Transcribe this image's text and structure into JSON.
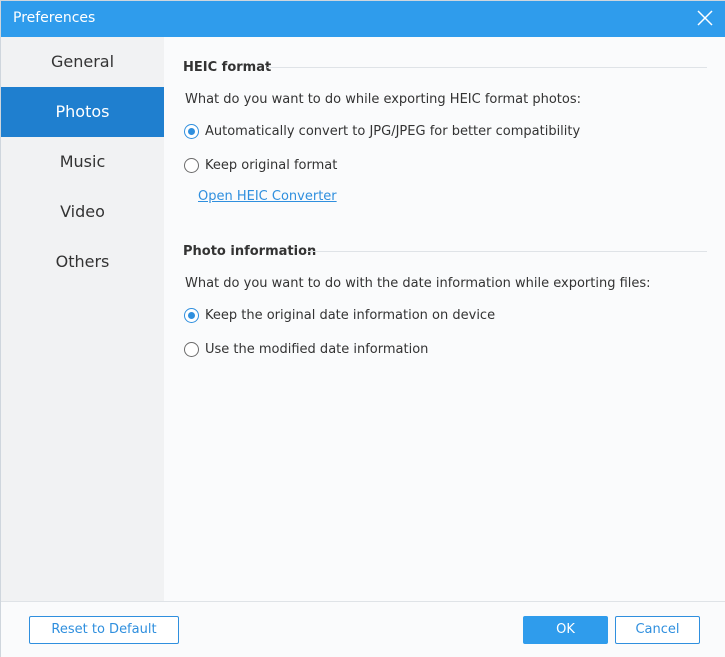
{
  "window": {
    "title": "Preferences"
  },
  "sidebar": {
    "items": [
      {
        "label": "General"
      },
      {
        "label": "Photos",
        "active": true
      },
      {
        "label": "Music"
      },
      {
        "label": "Video"
      },
      {
        "label": "Others"
      }
    ]
  },
  "heic": {
    "title": "HEIC format",
    "question": "What do you want to do while exporting HEIC format photos:",
    "options": [
      {
        "label": "Automatically convert to JPG/JPEG for better compatibility",
        "checked": true
      },
      {
        "label": "Keep original format",
        "checked": false
      }
    ],
    "link": "Open HEIC Converter"
  },
  "photo_info": {
    "title": "Photo information",
    "question": "What do you want to do with the date information while exporting files:",
    "options": [
      {
        "label": "Keep the original date information on device",
        "checked": true
      },
      {
        "label": "Use the modified date information",
        "checked": false
      }
    ]
  },
  "footer": {
    "reset_label": "Reset to Default",
    "ok_label": "OK",
    "cancel_label": "Cancel"
  },
  "colors": {
    "titlebar": "#2f9cec",
    "active_nav": "#1f7fcf",
    "accent": "#2f8fde"
  }
}
